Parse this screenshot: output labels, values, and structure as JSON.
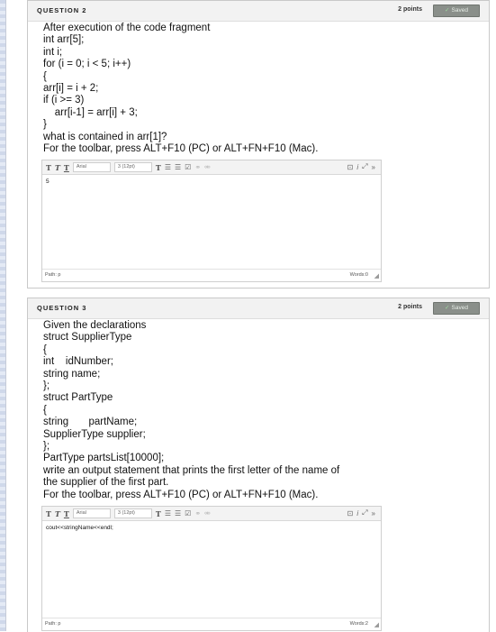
{
  "question2": {
    "title": "QUESTION 2",
    "points": "2 points",
    "saved": "Saved",
    "lines": [
      "After execution of the code fragment",
      "int arr[5];",
      "int i;",
      "for (i = 0; i < 5; i++)",
      "{",
      "arr[i] = i + 2;",
      "if (i >= 3)",
      "    arr[i-1] = arr[i] + 3;",
      "}",
      "what is contained in arr[1]?",
      "For the toolbar, press ALT+F10 (PC) or ALT+FN+F10 (Mac)."
    ],
    "editor": {
      "font": "Arial",
      "size": "3 (12pt)",
      "content": "5",
      "path": "Path: p",
      "words": "Words:0"
    }
  },
  "question3": {
    "title": "QUESTION 3",
    "points": "2 points",
    "saved": "Saved",
    "lines": [
      "Given the declarations",
      "struct SupplierType",
      "{",
      "int    idNumber;",
      "string name;",
      "};",
      "struct PartType",
      "{",
      "string       partName;",
      "SupplierType supplier;",
      "};",
      "PartType partsList[10000];",
      "write an output statement that prints the first letter of the name of",
      "the supplier of the first part.",
      "For the toolbar, press ALT+F10 (PC) or ALT+FN+F10 (Mac)."
    ],
    "editor": {
      "font": "Arial",
      "size": "3 (12pt)",
      "content": "cout<<stringName<<endl;",
      "path": "Path: p",
      "words": "Words:2"
    }
  },
  "toolbar_icons": [
    "bold-icon",
    "italic-icon",
    "underline-icon",
    "text-color-icon",
    "bullet-list-icon",
    "numbered-list-icon",
    "spellcheck-icon",
    "link-icon",
    "unlink-icon",
    "insert-content-icon",
    "italic-i-icon",
    "fullscreen-icon",
    "expand-toolbar-icon"
  ]
}
